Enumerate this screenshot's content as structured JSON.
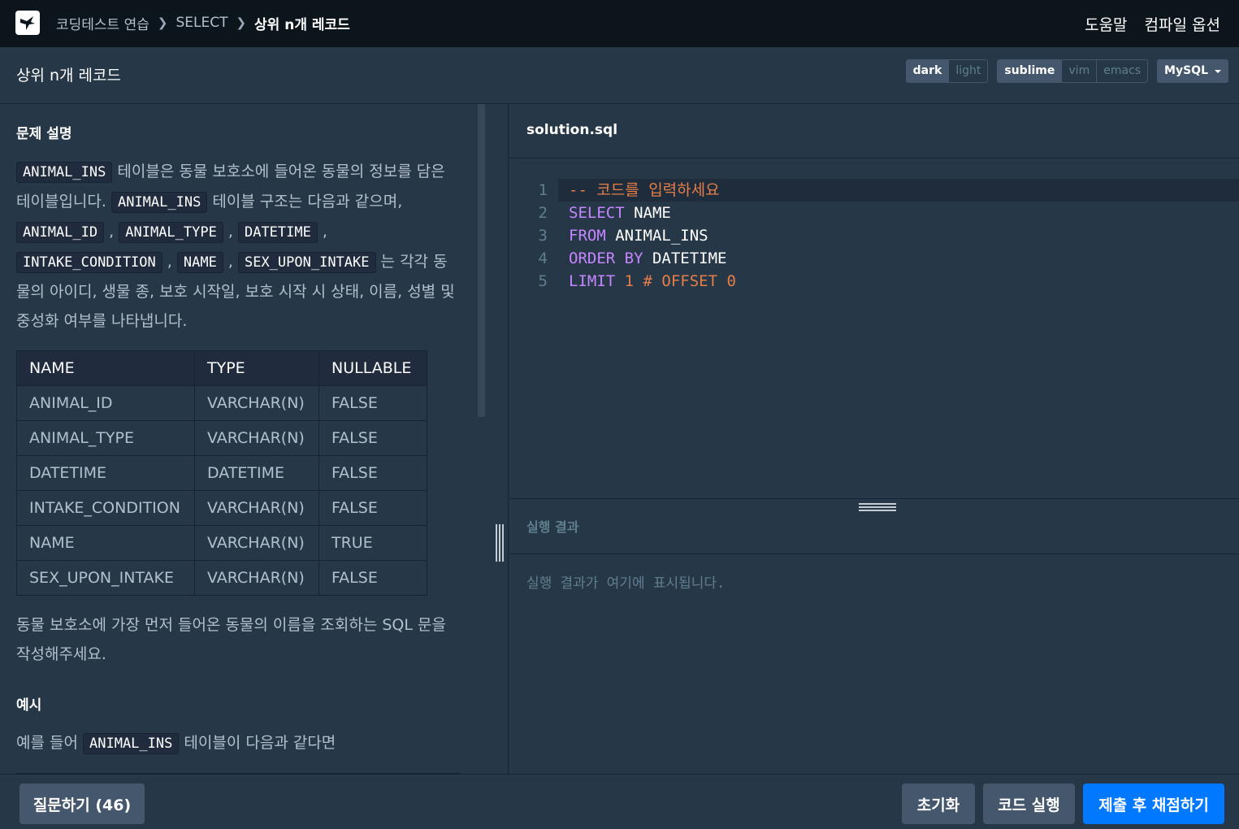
{
  "nav": {
    "breadcrumb": [
      "코딩테스트 연습",
      "SELECT",
      "상위 n개 레코드"
    ],
    "help": "도움말",
    "compile_options": "컴파일 옵션"
  },
  "title": "상위 n개 레코드",
  "toggles": {
    "theme": [
      "dark",
      "light"
    ],
    "theme_selected": "dark",
    "keymap": [
      "sublime",
      "vim",
      "emacs"
    ],
    "keymap_selected": "sublime",
    "language": "MySQL"
  },
  "guide": {
    "heading": "문제 설명",
    "para1": {
      "code1": "ANIMAL_INS",
      "text1": " 테이블은 동물 보호소에 들어온 동물의 정보를 담은 테이블입니다. ",
      "code2": "ANIMAL_INS",
      "text2": " 테이블 구조는 다음과 같으며, ",
      "cols": [
        "ANIMAL_ID",
        "ANIMAL_TYPE",
        "DATETIME",
        "INTAKE_CONDITION",
        "NAME",
        "SEX_UPON_INTAKE"
      ],
      "text3": "는 각각 동물의 아이디, 생물 종, 보호 시작일, 보호 시작 시 상태, 이름, 성별 및 중성화 여부를 나타냅니다."
    },
    "table": {
      "headers": [
        "NAME",
        "TYPE",
        "NULLABLE"
      ],
      "rows": [
        [
          "ANIMAL_ID",
          "VARCHAR(N)",
          "FALSE"
        ],
        [
          "ANIMAL_TYPE",
          "VARCHAR(N)",
          "FALSE"
        ],
        [
          "DATETIME",
          "DATETIME",
          "FALSE"
        ],
        [
          "INTAKE_CONDITION",
          "VARCHAR(N)",
          "FALSE"
        ],
        [
          "NAME",
          "VARCHAR(N)",
          "TRUE"
        ],
        [
          "SEX_UPON_INTAKE",
          "VARCHAR(N)",
          "FALSE"
        ]
      ]
    },
    "para2": "동물 보호소에 가장 먼저 들어온 동물의 이름을 조회하는 SQL 문을 작성해주세요.",
    "example_heading": "예시",
    "example": {
      "text1": "예를 들어 ",
      "code": "ANIMAL_INS",
      "text2": " 테이블이 다음과 같다면"
    }
  },
  "editor": {
    "filename": "solution.sql",
    "line_numbers": [
      "1",
      "2",
      "3",
      "4",
      "5"
    ],
    "lines": [
      {
        "parts": [
          {
            "t": "-- 코드를 입력하세요",
            "c": "cm"
          }
        ]
      },
      {
        "parts": [
          {
            "t": "SELECT",
            "c": "kw"
          },
          {
            "t": " NAME",
            "c": ""
          }
        ]
      },
      {
        "parts": [
          {
            "t": "FROM",
            "c": "kw"
          },
          {
            "t": " ANIMAL_INS",
            "c": ""
          }
        ]
      },
      {
        "parts": [
          {
            "t": "ORDER",
            "c": "kw"
          },
          {
            "t": " ",
            "c": ""
          },
          {
            "t": "BY",
            "c": "kw"
          },
          {
            "t": " DATETIME",
            "c": ""
          }
        ]
      },
      {
        "parts": [
          {
            "t": "LIMIT",
            "c": "kw"
          },
          {
            "t": " ",
            "c": ""
          },
          {
            "t": "1",
            "c": "num"
          },
          {
            "t": " # OFFSET 0",
            "c": "cm"
          }
        ]
      }
    ]
  },
  "result": {
    "label": "실행 결과",
    "placeholder": "실행 결과가 여기에 표시됩니다."
  },
  "buttons": {
    "qa": "질문하기 (46)",
    "reset": "초기화",
    "run": "코드 실행",
    "submit": "제출 후 채점하기"
  },
  "colors": {
    "accent": "#0078ff",
    "keyword": "#c586ff",
    "comment": "#e67e48"
  }
}
